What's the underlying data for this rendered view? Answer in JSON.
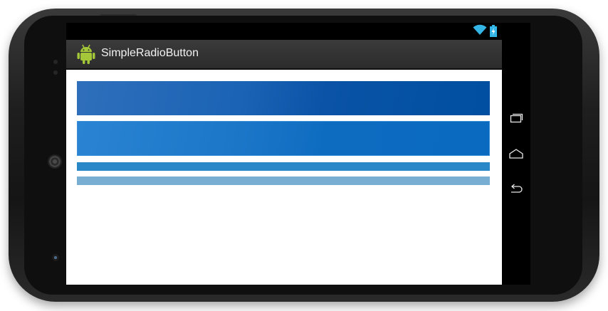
{
  "app": {
    "title": "SimpleRadioButton",
    "icon": "android-icon"
  },
  "status_bar": {
    "icons": [
      "wifi-icon",
      "battery-charging-icon"
    ]
  },
  "radio_buttons": [
    {
      "name": "radio-button-1",
      "color": "#1a5fb0"
    },
    {
      "name": "radio-button-2",
      "color": "#1471c4"
    },
    {
      "name": "radio-button-3",
      "color": "#2b88c8"
    },
    {
      "name": "radio-button-4",
      "color": "#77aed2"
    }
  ],
  "nav_bar": {
    "buttons": [
      "recent-apps-icon",
      "home-icon",
      "back-icon"
    ]
  },
  "colors": {
    "accent": "#33b5e5",
    "android_green": "#a4c639"
  }
}
